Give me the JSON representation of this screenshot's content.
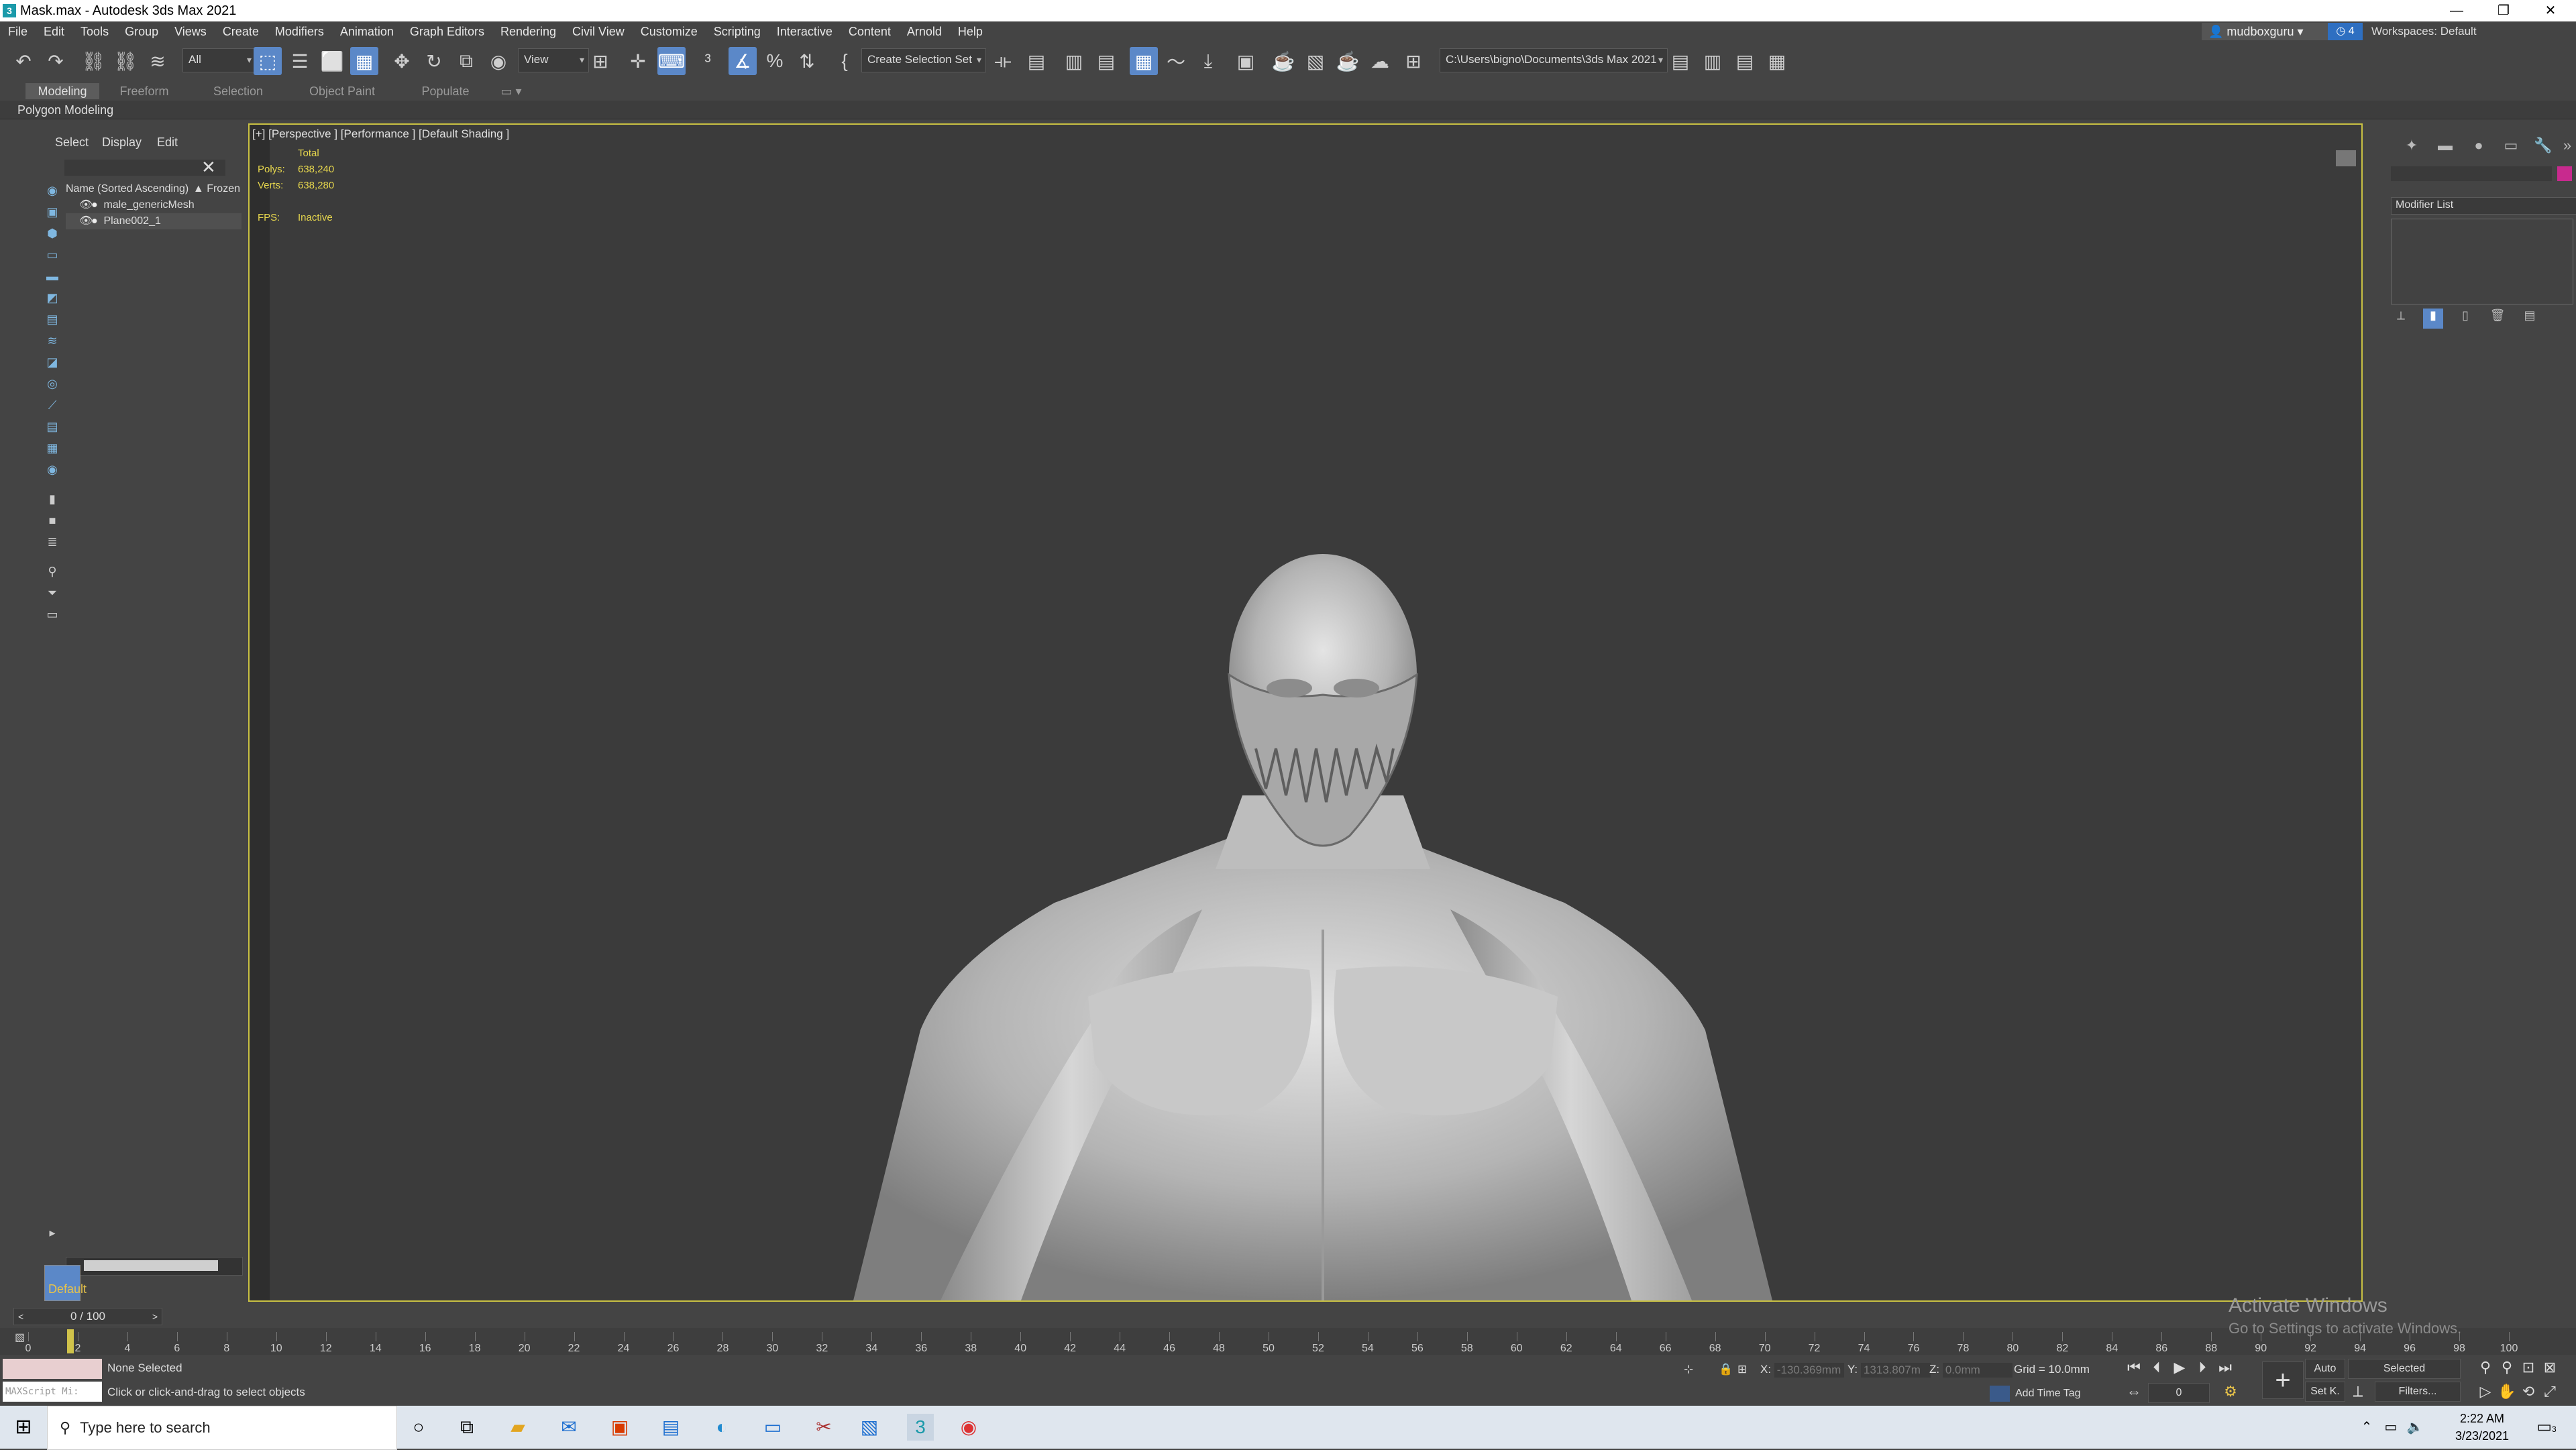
{
  "window": {
    "title": "Mask.max - Autodesk 3ds Max 2021",
    "minimize": "—",
    "restore": "❐",
    "close": "✕"
  },
  "menu": [
    "File",
    "Edit",
    "Tools",
    "Group",
    "Views",
    "Create",
    "Modifiers",
    "Animation",
    "Graph Editors",
    "Rendering",
    "Civil View",
    "Customize",
    "Scripting",
    "Interactive",
    "Content",
    "Arnold",
    "Help"
  ],
  "account": {
    "user": "mudboxguru",
    "notifications": "4",
    "workspaces_label": "Workspaces:",
    "workspace": "Default"
  },
  "toolbar": {
    "selection_filter": "All",
    "ref_coord": "View",
    "selection_set": "Create Selection Set",
    "project_path": "C:\\Users\\bigno\\Documents\\3ds Max 2021"
  },
  "ribbon": {
    "tabs": [
      "Modeling",
      "Freeform",
      "Selection",
      "Object Paint",
      "Populate"
    ],
    "active": "Modeling",
    "subpanel": "Polygon Modeling"
  },
  "explorer": {
    "tabs": [
      "Select",
      "Display",
      "Edit"
    ],
    "column": "Name (Sorted Ascending)",
    "frozen": "▲ Frozen",
    "rows": [
      {
        "name": "male_genericMesh"
      },
      {
        "name": "Plane002_1"
      }
    ],
    "layer": "Default"
  },
  "viewport": {
    "label": "[+] [Perspective ] [Performance ] [Default Shading ]",
    "total_label": "Total",
    "polys_label": "Polys:",
    "polys": "638,240",
    "verts_label": "Verts:",
    "verts": "638,280",
    "fps_label": "FPS:",
    "fps": "Inactive"
  },
  "command_panel": {
    "modifier_list": "Modifier List",
    "accent_color": "#c82a8e"
  },
  "timeline": {
    "frame_readout": "0 / 100",
    "ticks": [
      "0",
      "2",
      "4",
      "6",
      "8",
      "10",
      "12",
      "14",
      "16",
      "18",
      "20",
      "22",
      "24",
      "26",
      "28",
      "30",
      "32",
      "34",
      "36",
      "38",
      "40",
      "42",
      "44",
      "46",
      "48",
      "50",
      "52",
      "54",
      "56",
      "58",
      "60",
      "62",
      "64",
      "66",
      "68",
      "70",
      "72",
      "74",
      "76",
      "78",
      "80",
      "82",
      "84",
      "86",
      "88",
      "90",
      "92",
      "94",
      "96",
      "98",
      "100"
    ]
  },
  "status": {
    "maxscript": "MAXScript Mi:",
    "selection": "None Selected",
    "prompt": "Click or click-and-drag to select objects",
    "x_label": "X:",
    "x": "-130.369mm",
    "y_label": "Y:",
    "y": "1313.807m",
    "z_label": "Z:",
    "z": "0.0mm",
    "grid": "Grid = 10.0mm",
    "add_time_tag": "Add Time Tag",
    "auto": "Auto",
    "set_key": "Set K.",
    "key_filter": "Selected",
    "filters": "Filters...",
    "frame": "0"
  },
  "watermark": {
    "line1": "Activate Windows",
    "line2": "Go to Settings to activate Windows."
  },
  "taskbar": {
    "search_placeholder": "Type here to search",
    "time": "2:22 AM",
    "date": "3/23/2021",
    "notif_count": "3"
  }
}
